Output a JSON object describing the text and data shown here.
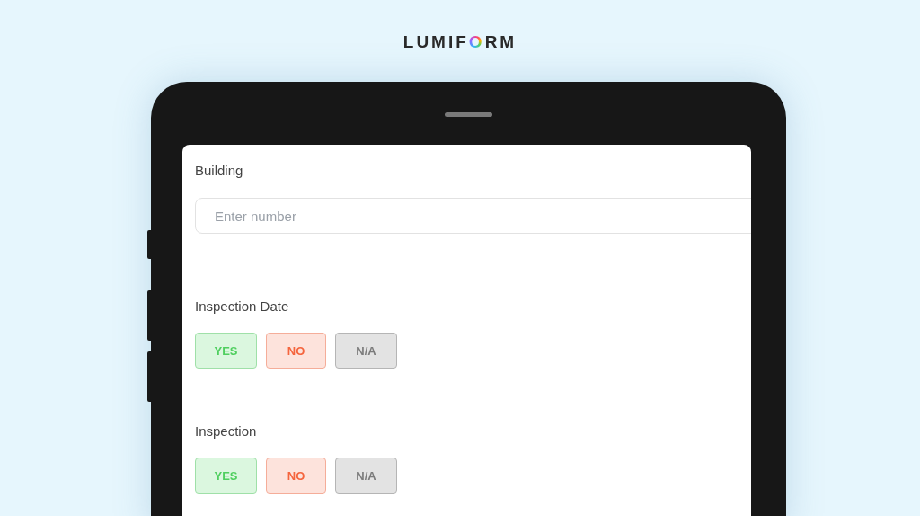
{
  "logo": {
    "text": "LUMIFORM"
  },
  "questions": [
    {
      "kind": "text",
      "label": "Building",
      "placeholder": "Enter number"
    },
    {
      "kind": "choice",
      "label": "Inspection Date",
      "options": [
        {
          "label": "YES",
          "kind": "yes"
        },
        {
          "label": "NO",
          "kind": "no"
        },
        {
          "label": "N/A",
          "kind": "na"
        }
      ]
    },
    {
      "kind": "choice",
      "label": "Inspection",
      "options": [
        {
          "label": "YES",
          "kind": "yes"
        },
        {
          "label": "NO",
          "kind": "no"
        },
        {
          "label": "N/A",
          "kind": "na"
        }
      ]
    }
  ]
}
